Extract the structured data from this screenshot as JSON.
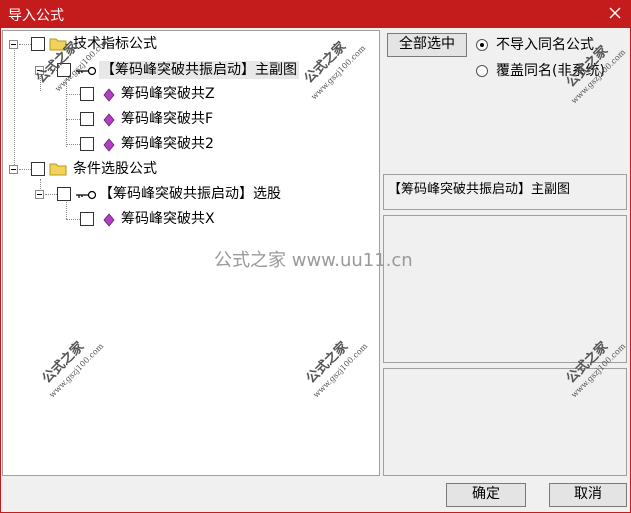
{
  "window": {
    "title": "导入公式"
  },
  "tree": {
    "groups": [
      {
        "label": "技术指标公式",
        "children": [
          {
            "label": "【筹码峰突破共振启动】主副图",
            "children": [
              {
                "label": "筹码峰突破共Z"
              },
              {
                "label": "筹码峰突破共F"
              },
              {
                "label": "筹码峰突破共2"
              }
            ]
          }
        ]
      },
      {
        "label": "条件选股公式",
        "children": [
          {
            "label": "【筹码峰突破共振启动】选股",
            "children": [
              {
                "label": "筹码峰突破共X"
              }
            ]
          }
        ]
      }
    ]
  },
  "options": {
    "select_all_label": "全部选中",
    "radio_no_import": "不导入同名公式",
    "radio_overwrite": "覆盖同名(非系统)",
    "selected_radio": "no_import"
  },
  "info": {
    "selected_formula": "【筹码峰突破共振启动】主副图"
  },
  "footer": {
    "ok_label": "确定",
    "cancel_label": "取消"
  },
  "watermark": {
    "site_name": "公式之家",
    "site_url": "www.gszj100.com",
    "center_text": "公式之家 www.uu11.cn"
  },
  "colors": {
    "titlebar": "#c41c1c",
    "folder": "#f2d35a",
    "gem": "#b040c0"
  }
}
